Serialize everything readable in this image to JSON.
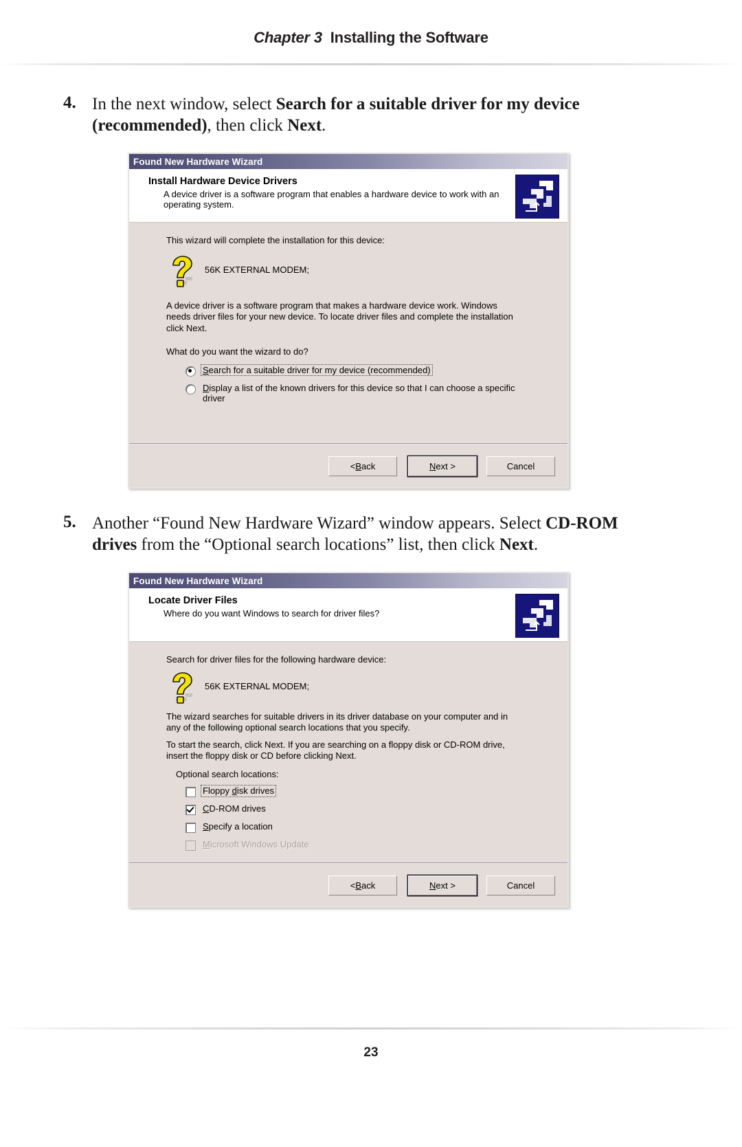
{
  "header": {
    "chapter": "Chapter 3",
    "title": "Installing the Software"
  },
  "footer": {
    "page_number": "23"
  },
  "steps": [
    {
      "number": "4.",
      "text_parts": {
        "p1": "In the next window, select ",
        "b1": "Search for a suitable driver for my device (recommended)",
        "p2": ", then click ",
        "b2": "Next",
        "p3": "."
      }
    },
    {
      "number": "5.",
      "text_parts": {
        "p1": "Another “Found New Hardware Wizard” window appears. Select ",
        "b1": "CD-ROM drives",
        "p2": " from the “Optional search locations” list, then click ",
        "b2": "Next",
        "p3": "."
      }
    }
  ],
  "dialog1": {
    "titlebar": "Found New Hardware Wizard",
    "banner_title": "Install Hardware Device Drivers",
    "banner_sub": "A device driver is a software program that enables a hardware device to work with an operating system.",
    "intro": "This wizard will complete the installation for this device:",
    "device_name": "56K EXTERNAL MODEM;",
    "paragraph": "A device driver is a software program that makes a hardware device work. Windows needs driver files for your new device. To locate driver files and complete the installation click Next.",
    "question": "What do you want the wizard to do?",
    "options": [
      {
        "acc": "S",
        "rest": "earch for a suitable driver for my device (recommended)",
        "selected": true,
        "focused": true
      },
      {
        "acc": "D",
        "rest": "isplay a list of the known drivers for this device so that I can choose a specific driver",
        "selected": false,
        "focused": false
      }
    ],
    "buttons": {
      "back_pre": "< ",
      "back_acc": "B",
      "back_rest": "ack",
      "next_acc": "N",
      "next_rest": "ext >",
      "cancel": "Cancel"
    }
  },
  "dialog2": {
    "titlebar": "Found New Hardware Wizard",
    "banner_title": "Locate Driver Files",
    "banner_sub": "Where do you want Windows to search for driver files?",
    "intro": "Search for driver files for the following hardware device:",
    "device_name": "56K EXTERNAL MODEM;",
    "paragraph1": "The wizard searches for suitable drivers in its driver database on your computer and in any of the following optional search locations that you specify.",
    "paragraph2": "To start the search, click Next. If you are searching on a floppy disk or CD-ROM drive, insert the floppy disk or CD before clicking Next.",
    "list_label": "Optional search locations:",
    "checkboxes": [
      {
        "acc_pre": "Floppy ",
        "acc": "d",
        "rest": "isk drives",
        "checked": false,
        "focused": true,
        "disabled": false
      },
      {
        "acc_pre": "",
        "acc": "C",
        "rest": "D-ROM drives",
        "checked": true,
        "focused": false,
        "disabled": false
      },
      {
        "acc_pre": "",
        "acc": "S",
        "rest": "pecify a location",
        "checked": false,
        "focused": false,
        "disabled": false
      },
      {
        "acc_pre": "",
        "acc": "M",
        "rest": "icrosoft Windows Update",
        "checked": false,
        "focused": false,
        "disabled": true
      }
    ],
    "buttons": {
      "back_pre": "< ",
      "back_acc": "B",
      "back_rest": "ack",
      "next_acc": "N",
      "next_rest": "ext >",
      "cancel": "Cancel"
    }
  },
  "colors": {
    "titlebar_start": "#4a4a72",
    "titlebar_end": "#d5d5e0",
    "dialog_face": "#e3dcd8",
    "icon_blue": "#15157a",
    "device_icon_yellow": "#f5e400"
  }
}
